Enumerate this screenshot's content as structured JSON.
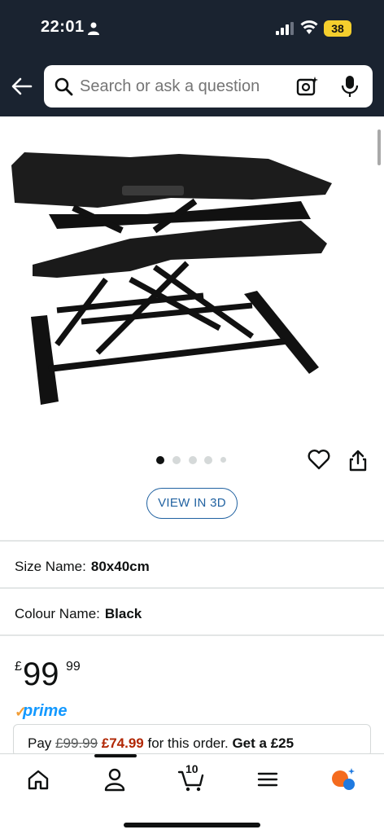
{
  "status_bar": {
    "time": "22:01",
    "battery": "38",
    "icons": [
      "person-icon",
      "signal-icon",
      "wifi-icon",
      "battery-icon"
    ]
  },
  "header": {
    "back_icon": "back-arrow-icon",
    "search": {
      "placeholder": "Search or ask a question"
    },
    "icons": [
      "search-icon",
      "camera-icon",
      "mic-icon"
    ]
  },
  "gallery": {
    "image_count": 5,
    "current_index": 0,
    "view_3d_label": "VIEW IN 3D"
  },
  "variations": [
    {
      "label": "Size Name:",
      "value": "80x40cm"
    },
    {
      "label": "Colour Name:",
      "value": "Black"
    }
  ],
  "price": {
    "currency": "£",
    "whole": "99",
    "fraction": "99"
  },
  "prime": {
    "check": "✓",
    "label": "prime"
  },
  "offer": {
    "prefix": "Pay",
    "old_price": "£99.99",
    "new_price": "£74.99",
    "middle": "for this order.",
    "suffix": "Get a £25"
  },
  "bottom_nav": {
    "items": [
      "home-icon",
      "account-icon",
      "cart-icon",
      "menu-icon",
      "rufus-icon"
    ],
    "cart_count": "10",
    "active_index": 1
  },
  "colors": {
    "header_bg": "#1a2330",
    "link_blue": "#2162a1",
    "deal_red": "#b12704",
    "prime_blue": "#1399ff",
    "prime_orange": "#f19e38",
    "battery_yellow": "#f5cf2d"
  }
}
